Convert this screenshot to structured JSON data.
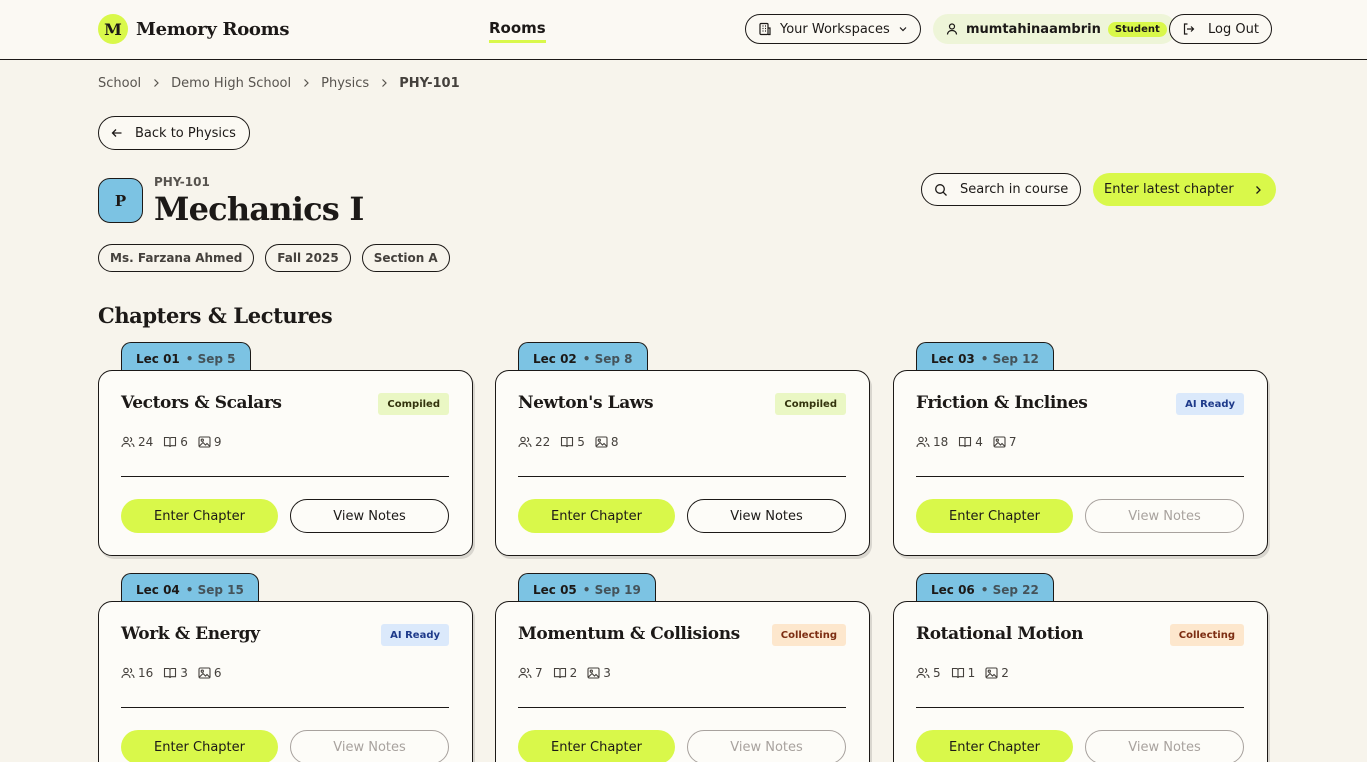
{
  "app": {
    "logo_letter": "M",
    "name": "Memory Rooms"
  },
  "nav": {
    "rooms": "Rooms",
    "workspaces": "Your Workspaces",
    "username": "mumtahinaambrin",
    "role": "Student",
    "logout": "Log Out"
  },
  "breadcrumb": [
    "School",
    "Demo High School",
    "Physics",
    "PHY-101"
  ],
  "back_label": "Back to Physics",
  "course": {
    "avatar_letter": "P",
    "code": "PHY-101",
    "title": "Mechanics I",
    "search_label": "Search in course",
    "latest_label": "Enter latest chapter",
    "tags": [
      "Ms. Farzana Ahmed",
      "Fall 2025",
      "Section A"
    ]
  },
  "section_title": "Chapters & Lectures",
  "actions": {
    "enter": "Enter Chapter",
    "notes": "View Notes"
  },
  "colors": {
    "accent": "#d9f84a",
    "tab_blue": "#7cc3e3",
    "background": "#f7f4ec"
  },
  "chapters": [
    {
      "lec": "Lec 01",
      "date": "• Sep 5",
      "title": "Vectors & Scalars",
      "status": "Compiled",
      "status_kind": "compiled",
      "members": "24",
      "lectures": "6",
      "images": "9",
      "notes_enabled": true
    },
    {
      "lec": "Lec 02",
      "date": "• Sep 8",
      "title": "Newton's Laws",
      "status": "Compiled",
      "status_kind": "compiled",
      "members": "22",
      "lectures": "5",
      "images": "8",
      "notes_enabled": true
    },
    {
      "lec": "Lec 03",
      "date": "• Sep 12",
      "title": "Friction & Inclines",
      "status": "AI Ready",
      "status_kind": "ai",
      "members": "18",
      "lectures": "4",
      "images": "7",
      "notes_enabled": false
    },
    {
      "lec": "Lec 04",
      "date": "• Sep 15",
      "title": "Work & Energy",
      "status": "AI Ready",
      "status_kind": "ai",
      "members": "16",
      "lectures": "3",
      "images": "6",
      "notes_enabled": false
    },
    {
      "lec": "Lec 05",
      "date": "• Sep 19",
      "title": "Momentum & Collisions",
      "status": "Collecting",
      "status_kind": "collecting",
      "members": "7",
      "lectures": "2",
      "images": "3",
      "notes_enabled": false
    },
    {
      "lec": "Lec 06",
      "date": "• Sep 22",
      "title": "Rotational Motion",
      "status": "Collecting",
      "status_kind": "collecting",
      "members": "5",
      "lectures": "1",
      "images": "2",
      "notes_enabled": false
    }
  ]
}
